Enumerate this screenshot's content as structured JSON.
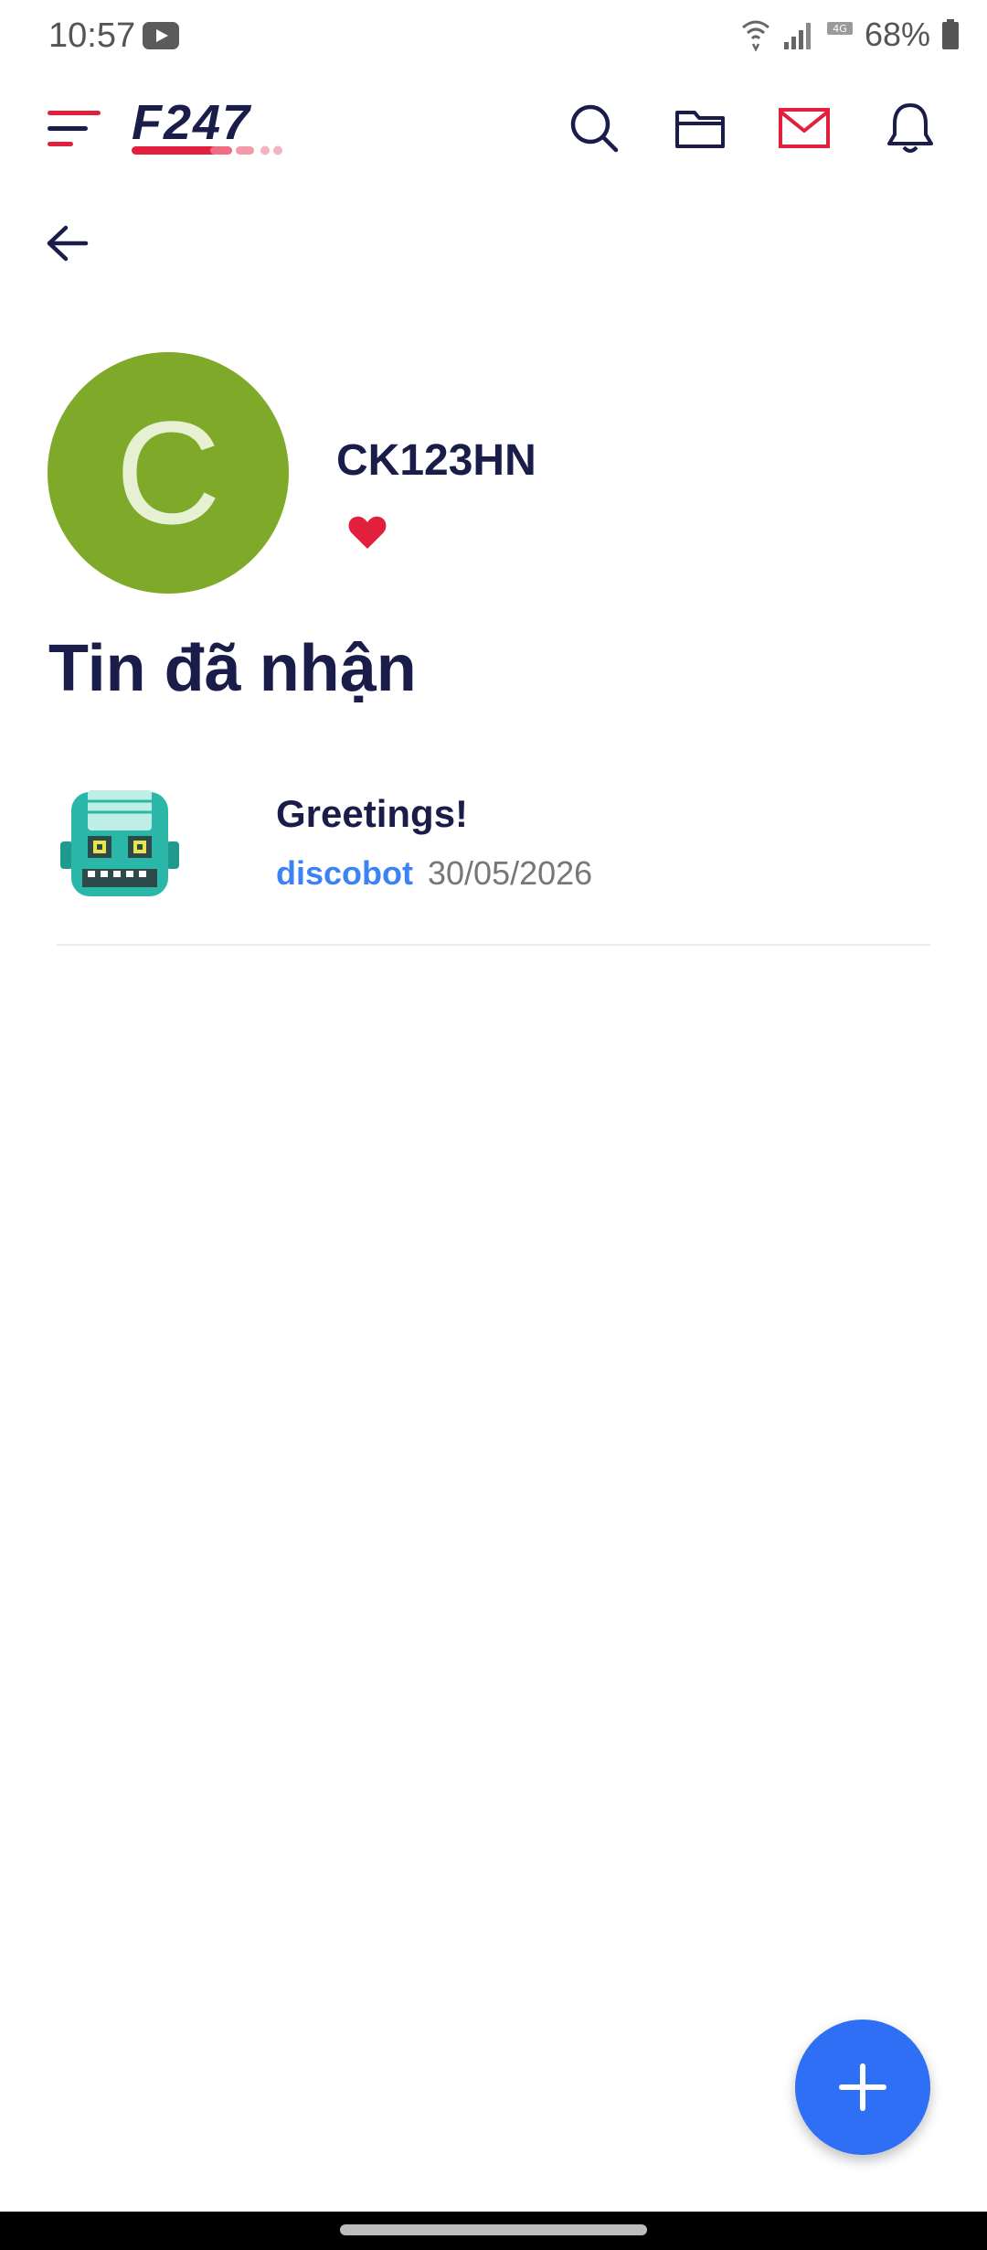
{
  "status_bar": {
    "time": "10:57",
    "battery": "68%",
    "network": "4G",
    "icons": [
      "youtube-icon",
      "wifi-icon",
      "signal-icon",
      "battery-icon"
    ]
  },
  "header": {
    "logo_text": "F247",
    "icons": [
      "menu-icon",
      "search-icon",
      "folder-icon",
      "mail-icon",
      "bell-icon"
    ],
    "accent_color": "#e21f3d"
  },
  "profile": {
    "avatar_letter": "C",
    "avatar_color": "#7fa929",
    "username": "CK123HN"
  },
  "section_title": "Tin đã nhận",
  "messages": [
    {
      "subject": "Greetings!",
      "sender": "discobot",
      "date": "30/05/2026"
    }
  ],
  "fab": {
    "icon": "plus-icon",
    "color": "#2e6ff5"
  }
}
